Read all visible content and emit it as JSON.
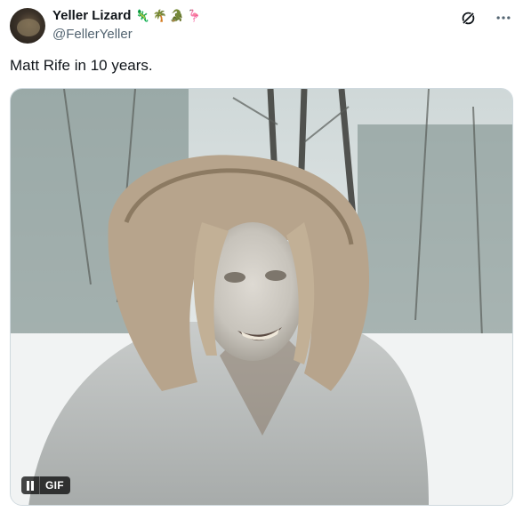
{
  "author": {
    "display_name": "Yeller Lizard",
    "handle": "@FellerYeller",
    "emojis": [
      "🦎",
      "🌴",
      "🐊",
      "🦩"
    ]
  },
  "tweet": {
    "text": "Matt Rife in 10 years."
  },
  "media": {
    "type": "gif",
    "badge_label": "GIF",
    "playback": "playing"
  },
  "icons": {
    "grok_icon": "grok-icon",
    "more_icon": "more-icon",
    "pause_icon": "pause-icon"
  }
}
